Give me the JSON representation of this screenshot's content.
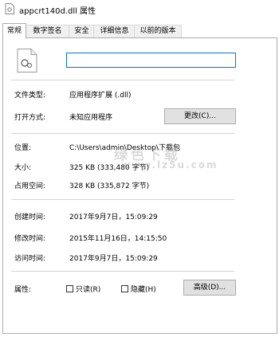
{
  "window": {
    "title": "appcrt140d.dll 属性"
  },
  "tabs": [
    "常规",
    "数字签名",
    "安全",
    "详细信息",
    "以前的版本"
  ],
  "file": {
    "name": ""
  },
  "general": {
    "type_label": "文件类型:",
    "type_value": "应用程序扩展 (.dll)",
    "open_with_label": "打开方式:",
    "open_with_value": "未知应用程序",
    "change_button": "更改(C)...",
    "location_label": "位置:",
    "location_value": "C:\\Users\\admin\\Desktop\\下载包",
    "size_label": "大小:",
    "size_value": "325 KB (333,480 字节)",
    "size_on_disk_label": "占用空间:",
    "size_on_disk_value": "328 KB (335,872 字节)",
    "created_label": "创建时间:",
    "created_value": "2017年9月7日，15:09:29",
    "modified_label": "修改时间:",
    "modified_value": "2015年11月16日，14:15:50",
    "accessed_label": "访问时间:",
    "accessed_value": "2017年9月7日，15:09:29",
    "attributes_label": "属性:",
    "readonly_label": "只读(R)",
    "hidden_label": "隐藏(H)",
    "advanced_button": "高级(D)..."
  },
  "watermark": {
    "text": "绿色下载",
    "sub": "www.lz5u.com"
  },
  "colors": {
    "accent": "#0078d7",
    "button_bg": "#e1e1e1",
    "border": "#adadad"
  }
}
